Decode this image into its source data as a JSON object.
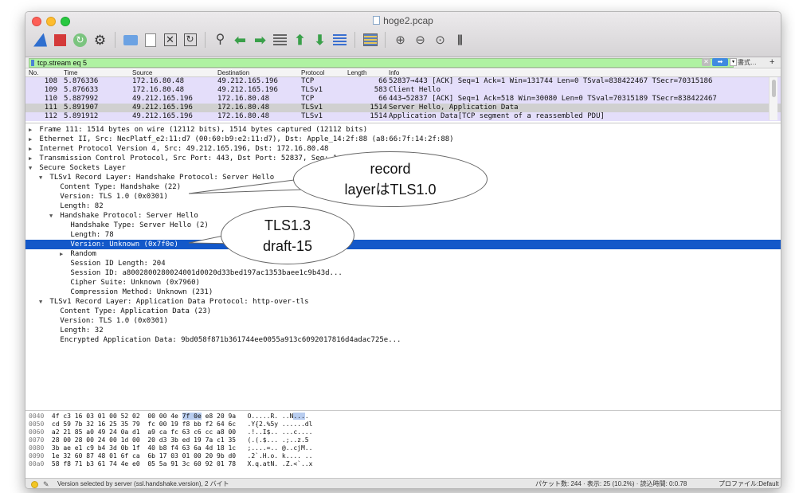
{
  "window": {
    "title": "hoge2.pcap"
  },
  "filter": {
    "value": "tcp.stream eq 5",
    "expression_label": "書式…",
    "plus_label": "+"
  },
  "columns": {
    "no": "No.",
    "time": "Time",
    "source": "Source",
    "destination": "Destination",
    "protocol": "Protocol",
    "length": "Length",
    "info": "Info"
  },
  "packets": [
    {
      "no": "108",
      "time": "5.876336",
      "src": "172.16.80.48",
      "dst": "49.212.165.196",
      "proto": "TCP",
      "len": "66",
      "info": "52837→443 [ACK] Seq=1 Ack=1 Win=131744 Len=0 TSval=838422467 TSecr=70315186"
    },
    {
      "no": "109",
      "time": "5.876633",
      "src": "172.16.80.48",
      "dst": "49.212.165.196",
      "proto": "TLSv1",
      "len": "583",
      "info": "Client Hello"
    },
    {
      "no": "110",
      "time": "5.887992",
      "src": "49.212.165.196",
      "dst": "172.16.80.48",
      "proto": "TCP",
      "len": "66",
      "info": "443→52837 [ACK] Seq=1 Ack=518 Win=30080 Len=0 TSval=70315189 TSecr=838422467"
    },
    {
      "no": "111",
      "time": "5.891907",
      "src": "49.212.165.196",
      "dst": "172.16.80.48",
      "proto": "TLSv1",
      "len": "1514",
      "info": "Server Hello, Application Data"
    },
    {
      "no": "112",
      "time": "5.891912",
      "src": "49.212.165.196",
      "dst": "172.16.80.48",
      "proto": "TLSv1",
      "len": "1514",
      "info": "Application Data[TCP segment of a reassembled PDU]"
    }
  ],
  "details": [
    {
      "indent": 0,
      "tw": "▶",
      "text": "Frame 111: 1514 bytes on wire (12112 bits), 1514 bytes captured (12112 bits)"
    },
    {
      "indent": 0,
      "tw": "▶",
      "text": "Ethernet II, Src: NecPlatf_e2:11:d7 (00:60:b9:e2:11:d7), Dst: Apple_14:2f:88 (a8:66:7f:14:2f:88)"
    },
    {
      "indent": 0,
      "tw": "▶",
      "text": "Internet Protocol Version 4, Src: 49.212.165.196, Dst: 172.16.80.48"
    },
    {
      "indent": 0,
      "tw": "▶",
      "text": "Transmission Control Protocol, Src Port: 443, Dst Port: 52837, Seq: 1, A"
    },
    {
      "indent": 0,
      "tw": "▼",
      "text": "Secure Sockets Layer"
    },
    {
      "indent": 1,
      "tw": "▼",
      "text": "TLSv1 Record Layer: Handshake Protocol: Server Hello"
    },
    {
      "indent": 2,
      "tw": "",
      "text": "Content Type: Handshake (22)"
    },
    {
      "indent": 2,
      "tw": "",
      "text": "Version: TLS 1.0 (0x0301)"
    },
    {
      "indent": 2,
      "tw": "",
      "text": "Length: 82"
    },
    {
      "indent": 2,
      "tw": "▼",
      "text": "Handshake Protocol: Server Hello"
    },
    {
      "indent": 3,
      "tw": "",
      "text": "Handshake Type: Server Hello (2)"
    },
    {
      "indent": 3,
      "tw": "",
      "text": "Length: 78"
    },
    {
      "indent": 3,
      "tw": "",
      "text": "Version: Unknown (0x7f0e)",
      "selected": true
    },
    {
      "indent": 3,
      "tw": "▶",
      "text": "Random"
    },
    {
      "indent": 3,
      "tw": "",
      "text": "Session ID Length: 204"
    },
    {
      "indent": 3,
      "tw": "",
      "text": "Session ID: a8002800280024001d0020d33bed197ac1353baee1c9b43d..."
    },
    {
      "indent": 3,
      "tw": "",
      "text": "Cipher Suite: Unknown (0x7960)"
    },
    {
      "indent": 3,
      "tw": "",
      "text": "Compression Method: Unknown (231)"
    },
    {
      "indent": 1,
      "tw": "▼",
      "text": "TLSv1 Record Layer: Application Data Protocol: http-over-tls"
    },
    {
      "indent": 2,
      "tw": "",
      "text": "Content Type: Application Data (23)"
    },
    {
      "indent": 2,
      "tw": "",
      "text": "Version: TLS 1.0 (0x0301)"
    },
    {
      "indent": 2,
      "tw": "",
      "text": "Length: 32"
    },
    {
      "indent": 2,
      "tw": "",
      "text": "Encrypted Application Data: 9bd058f871b361744ee0055a913c6092017816d4adac725e..."
    }
  ],
  "annotations": {
    "record": {
      "line1": "record",
      "line2": "layerはTLS1.0"
    },
    "tls13": {
      "line1": "TLS1.3",
      "line2": "draft-15"
    }
  },
  "hex": [
    {
      "off": "0040",
      "pre": "4f c3 16 03 01 00 52 02  00 00 4e ",
      "hi": "7f 0e",
      "post": " e8 20 9a   ",
      "ascii_pre": "O.....R. ..N",
      "ascii_hi": "...",
      "ascii_post": ". "
    },
    {
      "off": "0050",
      "pre": "cd 59 7b 32 16 25 35 79  fc 00 19 f8 bb f2 64 6c   .Y{2.%5y ......dl",
      "hi": "",
      "post": "",
      "ascii_pre": "",
      "ascii_hi": "",
      "ascii_post": ""
    },
    {
      "off": "0060",
      "pre": "a2 21 85 a0 49 24 0a d1  a9 ca fc 63 c6 cc a8 00   .!..I$.. ...c....",
      "hi": "",
      "post": "",
      "ascii_pre": "",
      "ascii_hi": "",
      "ascii_post": ""
    },
    {
      "off": "0070",
      "pre": "28 00 28 00 24 00 1d 00  20 d3 3b ed 19 7a c1 35   (.(.$... .;..z.5",
      "hi": "",
      "post": "",
      "ascii_pre": "",
      "ascii_hi": "",
      "ascii_post": ""
    },
    {
      "off": "0080",
      "pre": "3b ae e1 c9 b4 3d 0b 1f  40 b8 f4 63 6a 4d 18 1c   ;....=.. @..cjM..",
      "hi": "",
      "post": "",
      "ascii_pre": "",
      "ascii_hi": "",
      "ascii_post": ""
    },
    {
      "off": "0090",
      "pre": "1e 32 60 87 48 01 6f ca  6b 17 03 01 00 20 9b d0   .2`.H.o. k.... ..",
      "hi": "",
      "post": "",
      "ascii_pre": "",
      "ascii_hi": "",
      "ascii_post": ""
    },
    {
      "off": "00a0",
      "pre": "58 f8 71 b3 61 74 4e e0  05 5a 91 3c 60 92 01 78   X.q.atN. .Z.<`..x",
      "hi": "",
      "post": "",
      "ascii_pre": "",
      "ascii_hi": "",
      "ascii_post": ""
    }
  ],
  "status": {
    "message": "Version selected by server (ssl.handshake.version), 2 バイト",
    "stats": "パケット数: 244 · 表示: 25 (10.2%) · 読込時間: 0:0.78",
    "profile": "プロファイル:Default"
  },
  "colors": {
    "selected_row": "#1358c9",
    "tcp_row": "#e4defa",
    "filter_ok": "#aff2a2"
  },
  "toolbar_icons": [
    "shark-fin-icon",
    "stop-icon",
    "restart-icon",
    "gear-icon",
    "folder-icon",
    "file-icon",
    "close-file-icon",
    "reload-icon",
    "search-icon",
    "back-icon",
    "forward-icon",
    "go-to-packet-icon",
    "first-packet-icon",
    "last-packet-icon",
    "autoscroll-icon",
    "colorize-icon",
    "zoom-in-icon",
    "zoom-out-icon",
    "zoom-reset-icon",
    "resize-columns-icon"
  ]
}
